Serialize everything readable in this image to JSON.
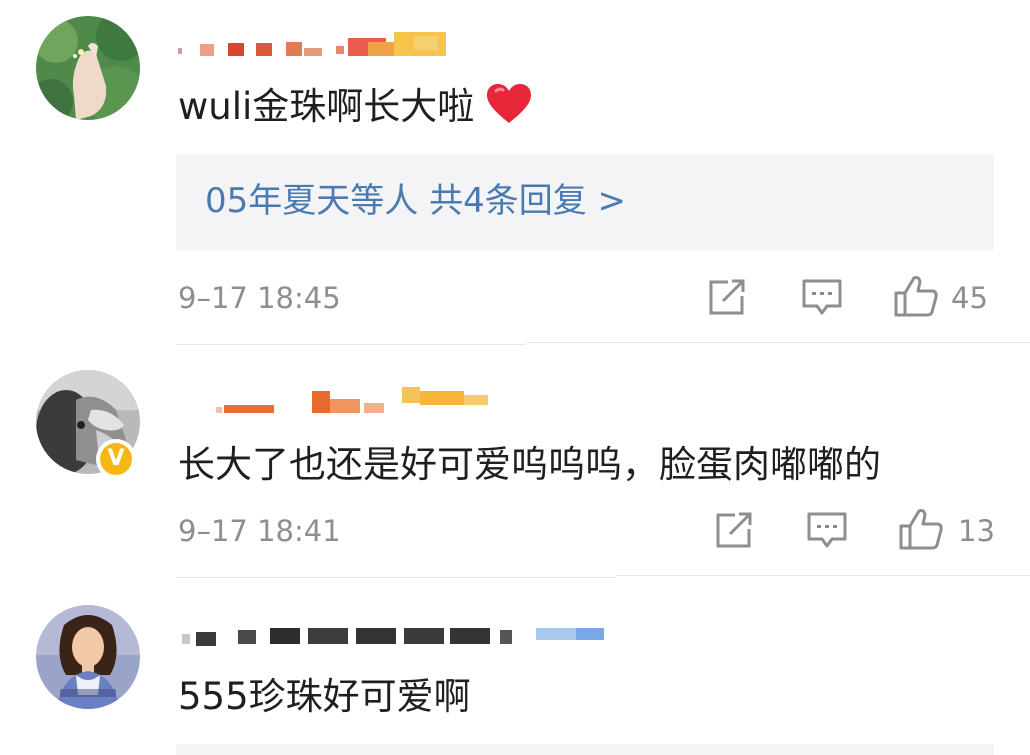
{
  "comments": [
    {
      "text": "wuli金珠啊长大啦",
      "reply_summary": "05年夏天等人  共4条回复 >",
      "timestamp": "9–17 18:45",
      "likes": "45"
    },
    {
      "text": "长大了也还是好可爱呜呜呜，脸蛋肉嘟嘟的",
      "timestamp": "9–17 18:41",
      "likes": "13",
      "verified_badge": "V"
    },
    {
      "text": "555珍珠好可爱啊"
    }
  ],
  "icons": {
    "share": "share-icon",
    "reply": "comment-icon",
    "like": "thumbs-up-icon",
    "heart": "red-heart-icon"
  },
  "colors": {
    "reply_link": "#4a7ab0",
    "meta_text": "#8e8e8e",
    "verified": "#f6b616",
    "heart": "#e8263a"
  }
}
